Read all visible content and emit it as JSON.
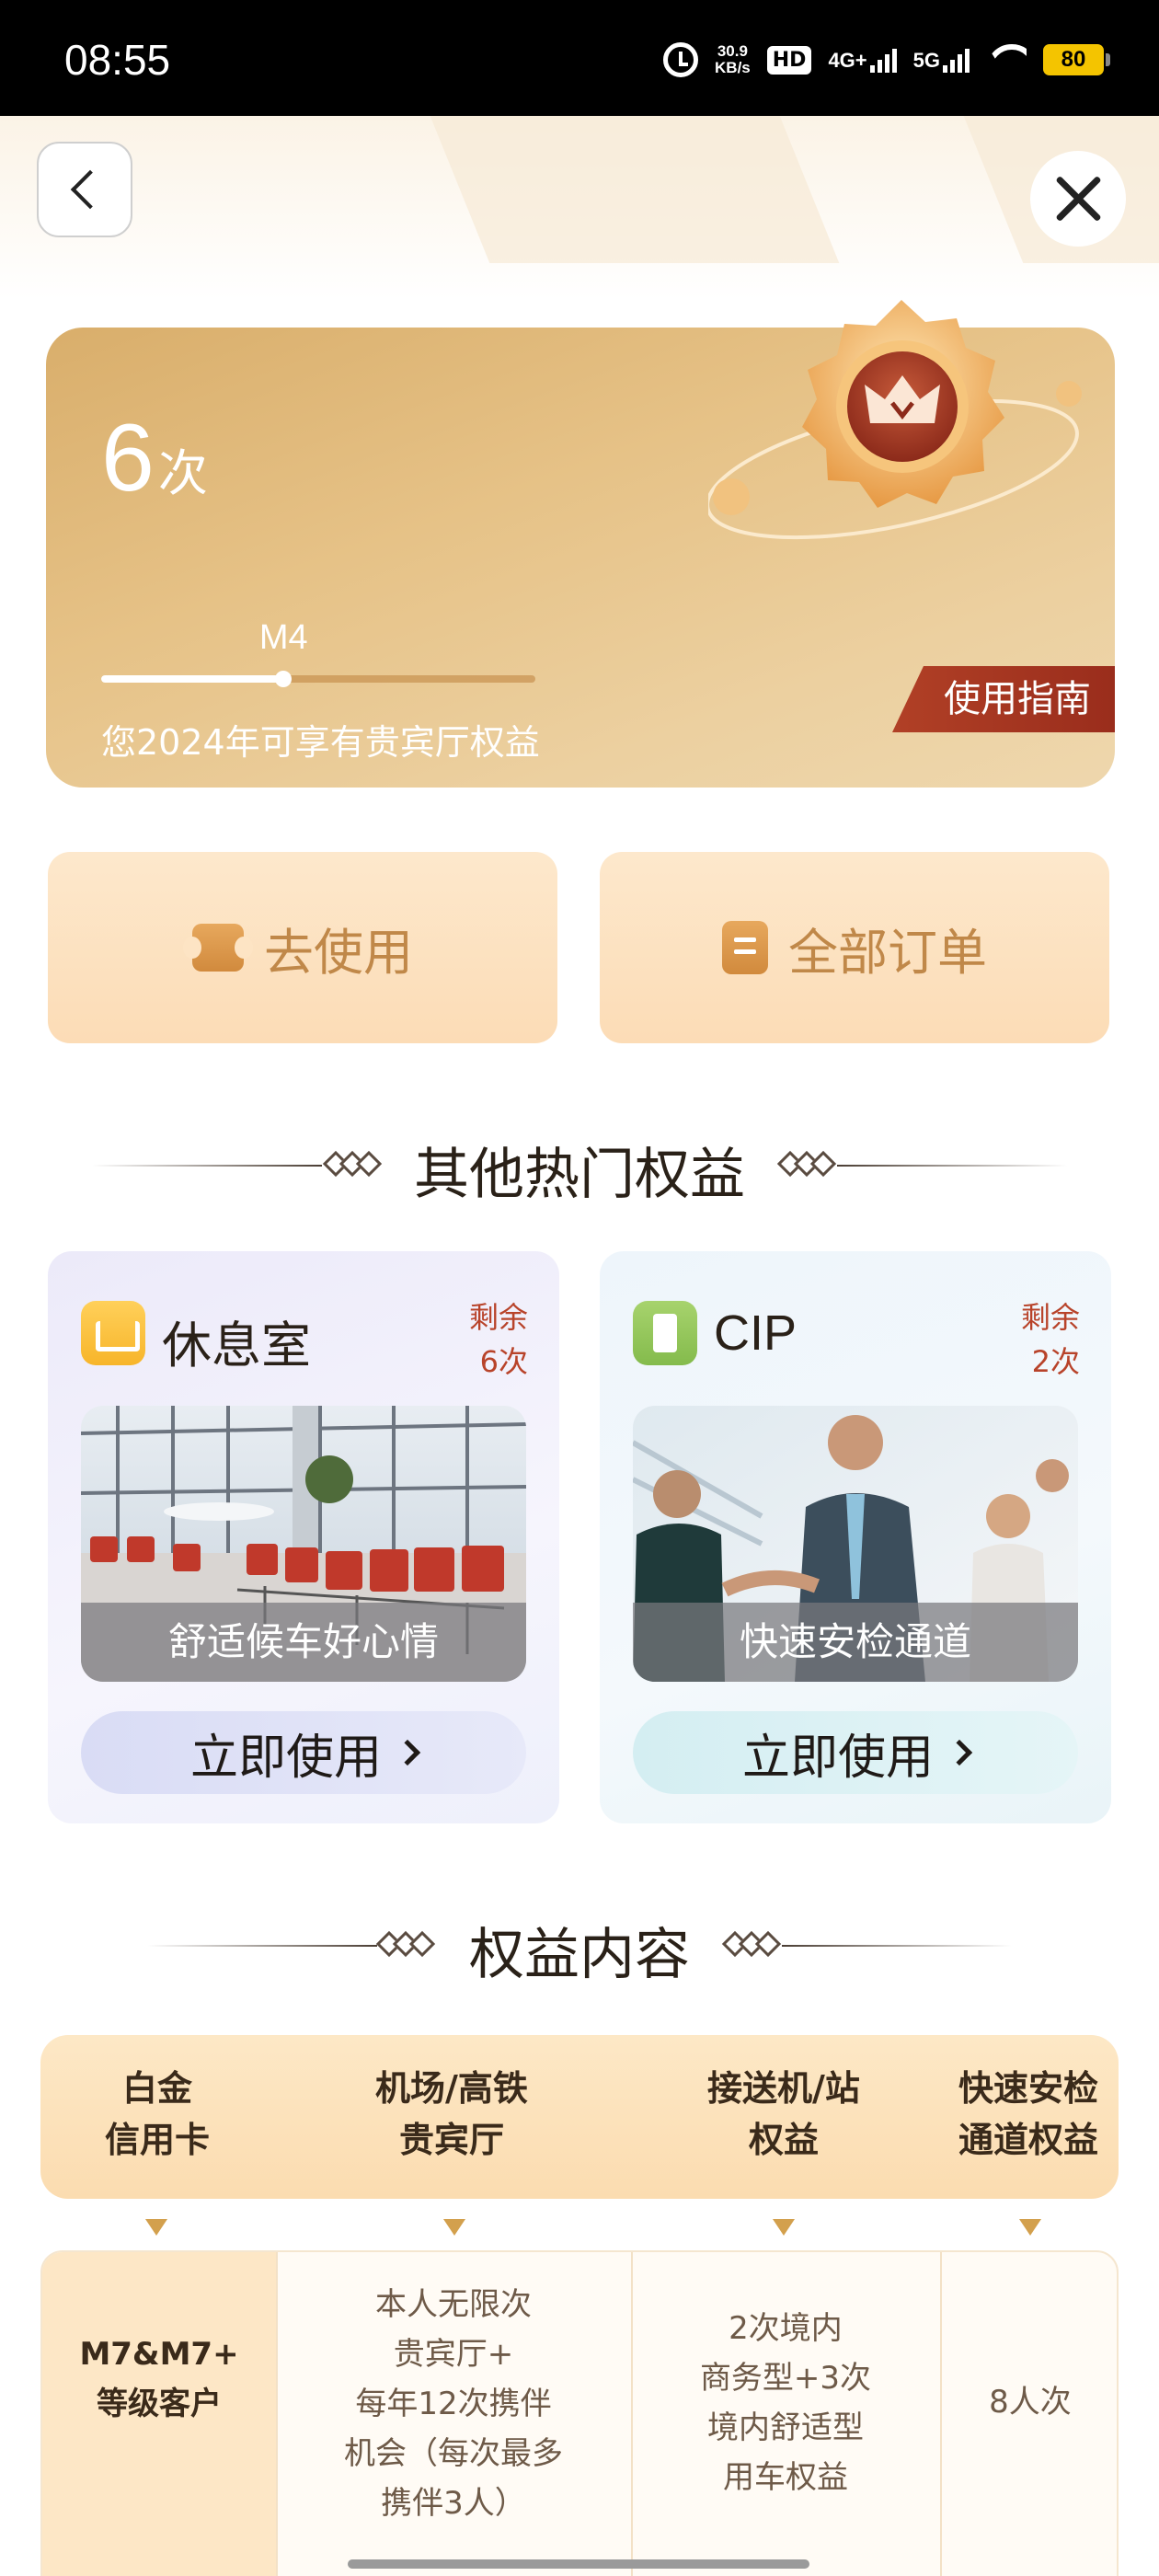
{
  "status_bar": {
    "time": "08:55",
    "net_speed_value": "30.9",
    "net_speed_unit": "KB/s",
    "hd_label": "HD",
    "network1": "4G+",
    "network2": "5G",
    "battery": "80"
  },
  "header": {
    "back_icon": "chevron-left-icon",
    "close_icon": "close-icon"
  },
  "membership_card": {
    "count": "6",
    "count_unit": "次",
    "level_label": "M4",
    "level_progress": 0.42,
    "description": "您2024年可享有贵宾厅权益",
    "guide_label": "使用指南"
  },
  "actions": {
    "use_label": "去使用",
    "orders_label": "全部订单"
  },
  "section_hot": {
    "title": "其他热门权益"
  },
  "benefits": [
    {
      "title": "休息室",
      "remain_label": "剩余",
      "remain_count": "6次",
      "caption": "舒适候车好心情",
      "button_label": "立即使用"
    },
    {
      "title": "CIP",
      "remain_label": "剩余",
      "remain_count": "2次",
      "caption": "快速安检通道",
      "button_label": "立即使用"
    }
  ],
  "section_content": {
    "title": "权益内容"
  },
  "table": {
    "headers": [
      [
        "白金",
        "信用卡"
      ],
      [
        "机场/高铁",
        "贵宾厅"
      ],
      [
        "接送机/站",
        "权益"
      ],
      [
        "快速安检",
        "通道权益"
      ]
    ],
    "row": {
      "tier": [
        "M7&M7+",
        "等级客户"
      ],
      "lounge": [
        "本人无限次",
        "贵宾厅+",
        "每年12次携伴",
        "机会（每次最多",
        "携伴3人）"
      ],
      "transfer": [
        "2次境内",
        "商务型+3次",
        "境内舒适型",
        "用车权益"
      ],
      "security": [
        "8人次"
      ]
    }
  },
  "colors": {
    "gold_card": "#e2bb7c",
    "accent_red": "#b14026",
    "action_bg": "#fde4c4",
    "action_text": "#c08849"
  }
}
